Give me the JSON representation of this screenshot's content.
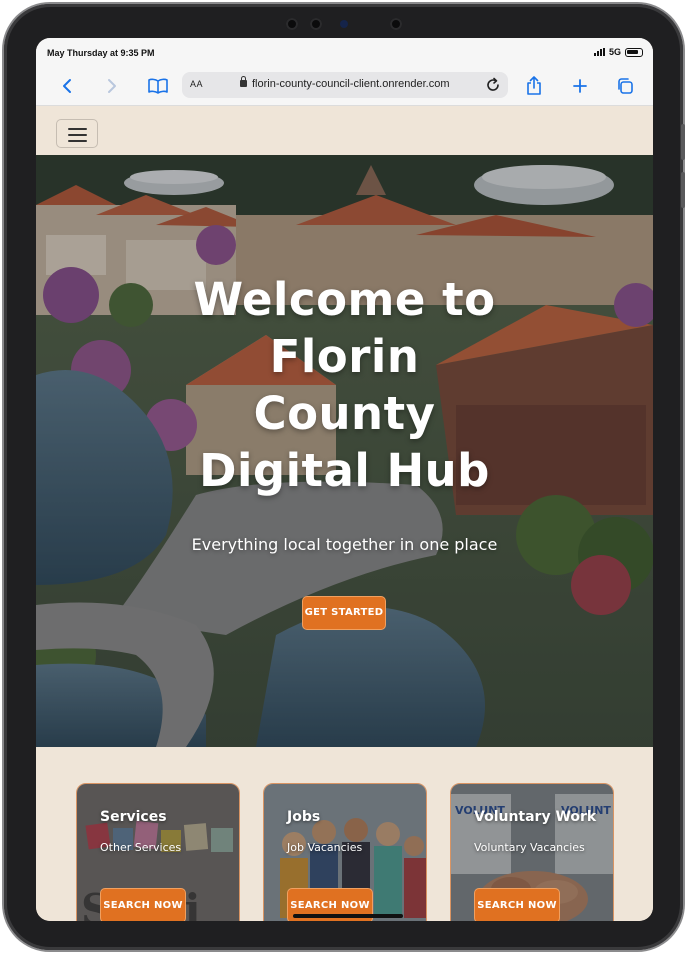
{
  "status": {
    "time": "May Thursday at 9:35 PM",
    "network": "5G"
  },
  "browser": {
    "text_size_label": "AA",
    "url": "florin-county-council-client.onrender.com",
    "icons": [
      "back-icon",
      "forward-icon",
      "bookmarks-icon",
      "lock-icon",
      "reload-icon",
      "share-icon",
      "new-tab-icon",
      "tabs-icon"
    ]
  },
  "nav": {
    "menu_icon": "hamburger-menu-icon"
  },
  "hero": {
    "title_lines": [
      "Welcome to",
      "Florin",
      "County",
      "Digital Hub"
    ],
    "subtitle": "Everything local together in one place",
    "button_label": "GET STARTED"
  },
  "cards": [
    {
      "title": "Services",
      "subtitle": "Other Services",
      "button_label": "SEARCH NOW"
    },
    {
      "title": "Jobs",
      "subtitle": "Job Vacancies",
      "button_label": "SEARCH NOW"
    },
    {
      "title": "Voluntary Work",
      "subtitle": "Voluntary Vacancies",
      "button_label": "SEARCH NOW"
    }
  ],
  "colors": {
    "accent": "#e07121",
    "page_background": "#efe5d8",
    "browser_blue": "#1a73e8"
  }
}
